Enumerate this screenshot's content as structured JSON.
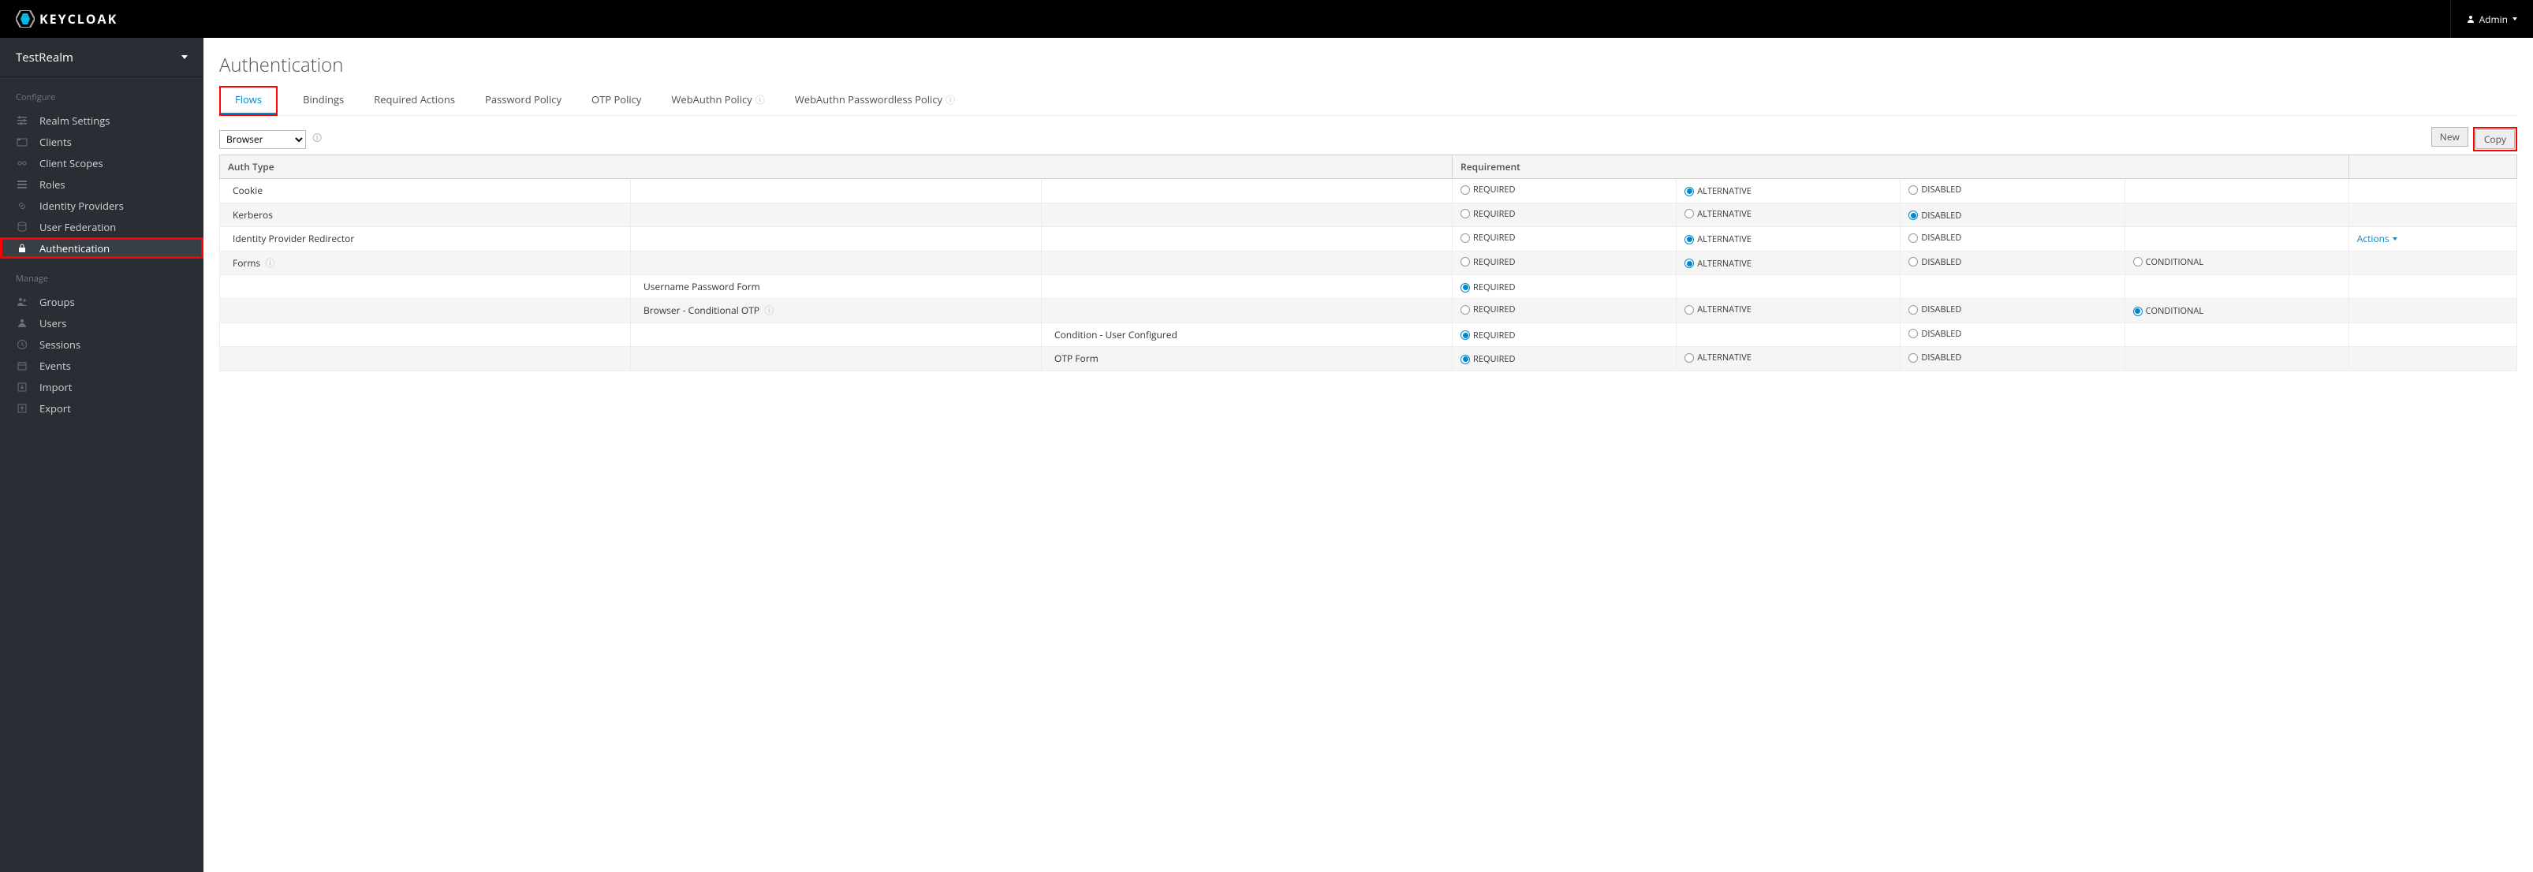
{
  "header": {
    "brand_text": "KEYCLOAK",
    "user_label": "Admin"
  },
  "sidebar": {
    "realm": "TestRealm",
    "groups": [
      {
        "title": "Configure",
        "items": [
          {
            "id": "realm-settings",
            "label": "Realm Settings",
            "icon": "sliders"
          },
          {
            "id": "clients",
            "label": "Clients",
            "icon": "tabs"
          },
          {
            "id": "client-scopes",
            "label": "Client Scopes",
            "icon": "scopes"
          },
          {
            "id": "roles",
            "label": "Roles",
            "icon": "list"
          },
          {
            "id": "identity-providers",
            "label": "Identity Providers",
            "icon": "link"
          },
          {
            "id": "user-federation",
            "label": "User Federation",
            "icon": "db"
          },
          {
            "id": "authentication",
            "label": "Authentication",
            "icon": "lock",
            "active": true,
            "highlighted": true
          }
        ]
      },
      {
        "title": "Manage",
        "items": [
          {
            "id": "groups",
            "label": "Groups",
            "icon": "users"
          },
          {
            "id": "users",
            "label": "Users",
            "icon": "user"
          },
          {
            "id": "sessions",
            "label": "Sessions",
            "icon": "clock"
          },
          {
            "id": "events",
            "label": "Events",
            "icon": "calendar"
          },
          {
            "id": "import",
            "label": "Import",
            "icon": "import"
          },
          {
            "id": "export",
            "label": "Export",
            "icon": "export"
          }
        ]
      }
    ]
  },
  "page": {
    "title": "Authentication",
    "tabs": [
      {
        "label": "Flows",
        "active": true,
        "highlighted": true
      },
      {
        "label": "Bindings"
      },
      {
        "label": "Required Actions"
      },
      {
        "label": "Password Policy"
      },
      {
        "label": "OTP Policy"
      },
      {
        "label": "WebAuthn Policy",
        "help": true
      },
      {
        "label": "WebAuthn Passwordless Policy",
        "help": true
      }
    ],
    "flow_selector": {
      "value": "Browser"
    },
    "buttons": {
      "new": "New",
      "copy": "Copy",
      "copy_highlighted": true
    },
    "table": {
      "headers": {
        "auth_type": "Auth Type",
        "requirement": "Requirement"
      },
      "actions_label": "Actions",
      "requirement_labels": {
        "REQUIRED": "REQUIRED",
        "ALTERNATIVE": "ALTERNATIVE",
        "DISABLED": "DISABLED",
        "CONDITIONAL": "CONDITIONAL"
      },
      "rows": [
        {
          "indent": 0,
          "label": "Cookie",
          "options": [
            "REQUIRED",
            "ALTERNATIVE",
            "DISABLED"
          ],
          "selected": "ALTERNATIVE"
        },
        {
          "indent": 0,
          "label": "Kerberos",
          "options": [
            "REQUIRED",
            "ALTERNATIVE",
            "DISABLED"
          ],
          "selected": "DISABLED"
        },
        {
          "indent": 0,
          "label": "Identity Provider Redirector",
          "options": [
            "REQUIRED",
            "ALTERNATIVE",
            "DISABLED"
          ],
          "selected": "ALTERNATIVE",
          "actions": true
        },
        {
          "indent": 0,
          "label": "Forms",
          "help": true,
          "options": [
            "REQUIRED",
            "ALTERNATIVE",
            "DISABLED",
            "CONDITIONAL"
          ],
          "selected": "ALTERNATIVE"
        },
        {
          "indent": 1,
          "label": "Username Password Form",
          "options": [
            "REQUIRED"
          ],
          "selected": "REQUIRED"
        },
        {
          "indent": 1,
          "label": "Browser - Conditional OTP",
          "help": true,
          "options": [
            "REQUIRED",
            "ALTERNATIVE",
            "DISABLED",
            "CONDITIONAL"
          ],
          "selected": "CONDITIONAL"
        },
        {
          "indent": 2,
          "label": "Condition - User Configured",
          "options": [
            "REQUIRED",
            "DISABLED"
          ],
          "selected": "REQUIRED"
        },
        {
          "indent": 2,
          "label": "OTP Form",
          "options": [
            "REQUIRED",
            "ALTERNATIVE",
            "DISABLED"
          ],
          "selected": "REQUIRED"
        }
      ]
    }
  }
}
